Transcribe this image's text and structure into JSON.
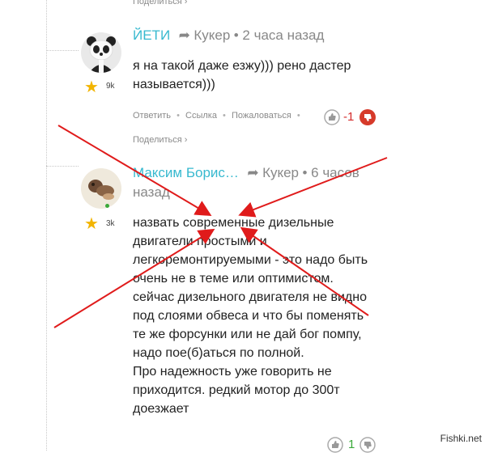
{
  "top_share_label": "Поделиться ›",
  "comment1": {
    "author": "ЙЕТИ",
    "reply_to": "Кукер",
    "time": "• 2 часа назад",
    "karma": "9k",
    "text_lines": [
      "я на такой даже езжу))) рено дастер",
      "называется)))"
    ],
    "actions": {
      "reply": "Ответить",
      "link": "Ссылка",
      "report": "Пожаловаться"
    },
    "vote_value": "-1",
    "share_label": "Поделиться ›"
  },
  "comment2": {
    "author": "Максим Борис…",
    "reply_to": "Кукер",
    "time_line1": "• 6 часов",
    "time_line2": "назад",
    "karma": "3k",
    "text_lines": [
      "назвать современные дизельные",
      "двигатели простыми и",
      "легкоремонтируемыми - это надо быть",
      "очень не в теме или оптимистом.",
      "сейчас дизельного двигателя не видно",
      "под слоями обвеса и что бы поменять",
      "те же форсунки или не дай бог помпу,",
      "надо пое(б)аться по полной.",
      "Про надежность уже говорить не",
      "приходится. редкий мотор до 300т",
      "доезжает"
    ],
    "vote_value": "1"
  },
  "watermark": "Fishki.net",
  "colors": {
    "author": "#37b9cf",
    "annotation_arrow": "#e01b1b",
    "vote_negative": "#d42a2a",
    "vote_positive": "#3aa93a"
  }
}
